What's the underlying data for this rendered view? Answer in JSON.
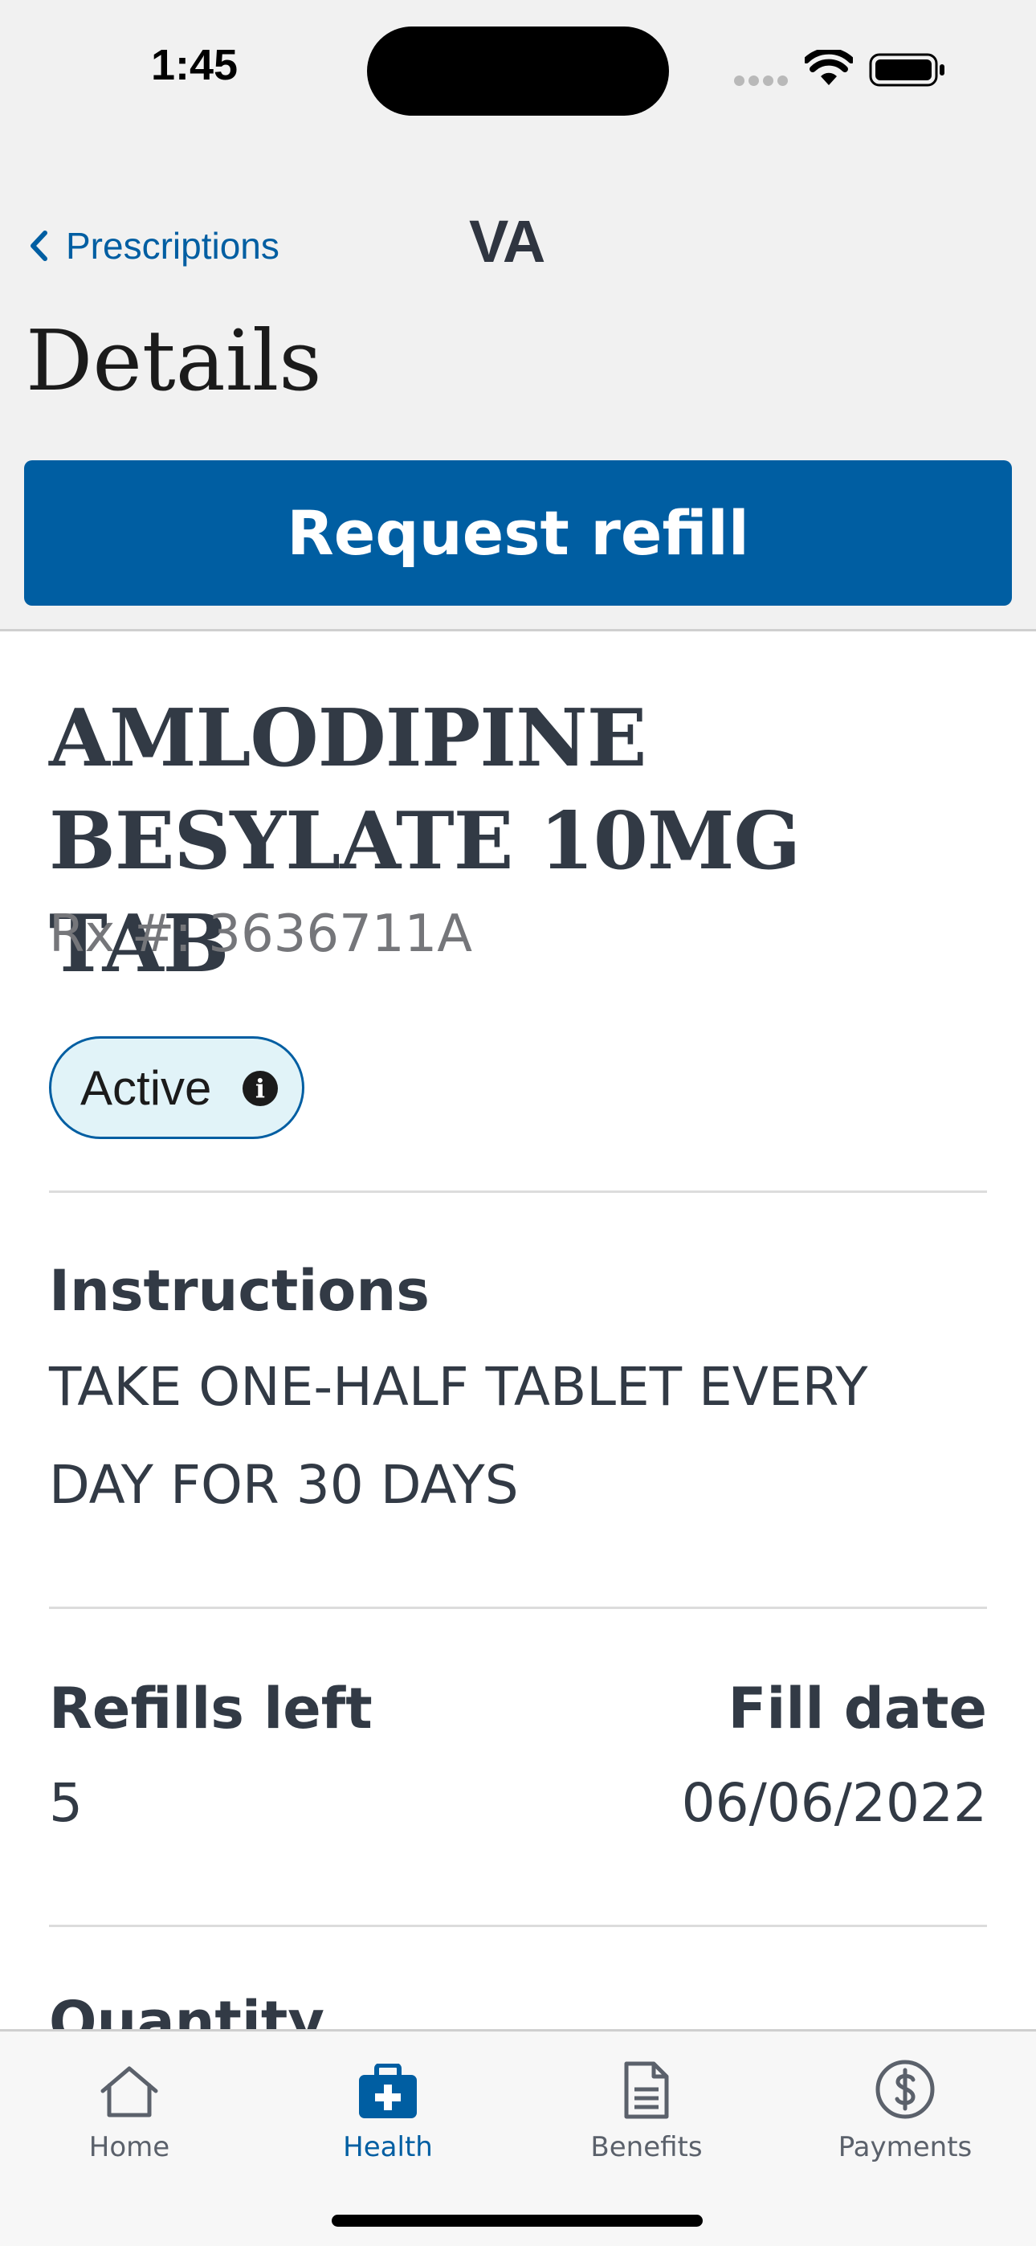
{
  "status_bar": {
    "time": "1:45"
  },
  "nav": {
    "back_label": "Prescriptions",
    "logo": "VA",
    "title": "Details"
  },
  "actions": {
    "request_refill": "Request refill"
  },
  "prescription": {
    "name": "AMLODIPINE BESYLATE 10MG TAB",
    "rx_number": "Rx #: 3636711A",
    "status": "Active",
    "instructions_label": "Instructions",
    "instructions": "TAKE ONE-HALF TABLET EVERY DAY FOR 30 DAYS",
    "refills_left_label": "Refills left",
    "refills_left": "5",
    "fill_date_label": "Fill date",
    "fill_date": "06/06/2022",
    "quantity_label": "Quantity"
  },
  "tabbar": {
    "items": [
      {
        "label": "Home",
        "icon": "home-icon",
        "active": false
      },
      {
        "label": "Health",
        "icon": "medical-kit-icon",
        "active": true
      },
      {
        "label": "Benefits",
        "icon": "document-icon",
        "active": false
      },
      {
        "label": "Payments",
        "icon": "dollar-icon",
        "active": false
      }
    ]
  },
  "colors": {
    "primary": "#005ea2",
    "text": "#323a45",
    "muted": "#75767a",
    "pill_bg": "#e1f3f8"
  }
}
